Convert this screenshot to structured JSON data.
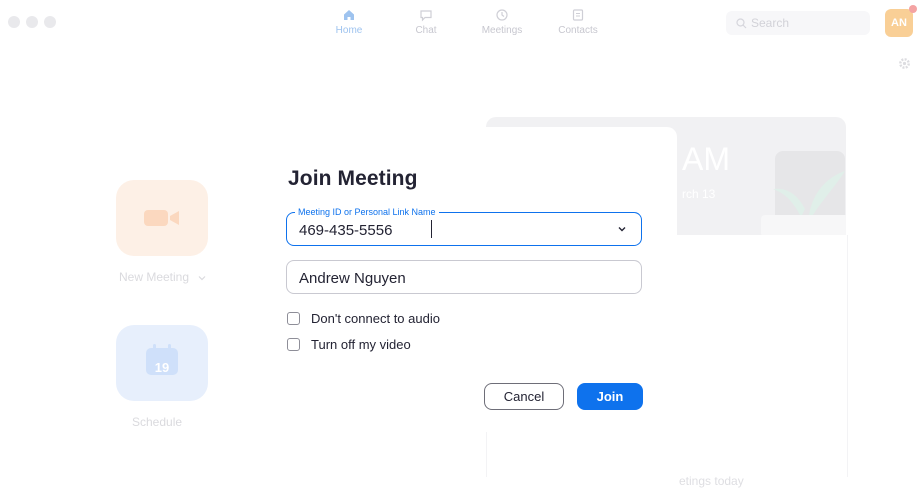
{
  "nav": {
    "tabs": [
      {
        "label": "Home",
        "icon": "home-icon"
      },
      {
        "label": "Chat",
        "icon": "chat-icon"
      },
      {
        "label": "Meetings",
        "icon": "clock-icon"
      },
      {
        "label": "Contacts",
        "icon": "contacts-icon"
      }
    ],
    "search_placeholder": "Search",
    "avatar_initials": "AN"
  },
  "home": {
    "new_meeting_label": "New Meeting",
    "schedule_label": "Schedule",
    "calendar_day": "19",
    "clock_fragment": "AM",
    "date_fragment": "rch 13",
    "no_meetings_fragment": "etings today"
  },
  "dialog": {
    "title": "Join Meeting",
    "meeting_field_label": "Meeting ID or Personal Link Name",
    "meeting_id_value": "469-435-5556",
    "name_value": "Andrew Nguyen",
    "checkbox_audio_label": "Don't connect to audio",
    "checkbox_audio_checked": false,
    "checkbox_video_label": "Turn off my video",
    "checkbox_video_checked": false,
    "cancel_label": "Cancel",
    "join_label": "Join"
  },
  "colors": {
    "accent": "#0e72ed",
    "text": "#232333",
    "avatar": "#f9cf96"
  }
}
